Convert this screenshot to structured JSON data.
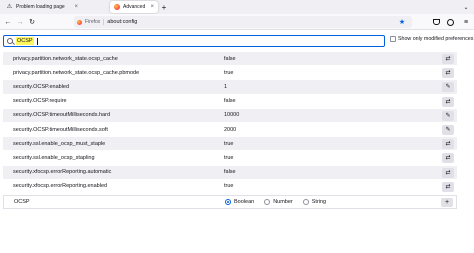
{
  "tabs": [
    {
      "title": "Problem loading page",
      "icon": "warning-icon",
      "active": false
    },
    {
      "title": "Advanced Preferences",
      "icon": "firefox-icon",
      "active": true
    }
  ],
  "tab_close_glyph": "×",
  "new_tab_glyph": "+",
  "tabs_menu_glyph": "⌄",
  "nav": {
    "back": "←",
    "forward": "→",
    "reload": "↻"
  },
  "urlbar": {
    "identity": "Firefox",
    "url": "about:config"
  },
  "toolbar_glyphs": {
    "star": "★",
    "menu": "≡"
  },
  "search": {
    "value": "OCSP"
  },
  "show_modified_label": "Show only modified preferences",
  "prefs": [
    {
      "name": "privacy.partition.network_state.ocsp_cache",
      "value": "false",
      "action": "toggle-icon",
      "glyph": "⇄"
    },
    {
      "name": "privacy.partition.network_state.ocsp_cache.pbmode",
      "value": "true",
      "action": "toggle-icon",
      "glyph": "⇄"
    },
    {
      "name": "security.OCSP.enabled",
      "value": "1",
      "action": "edit-icon",
      "glyph": "✎"
    },
    {
      "name": "security.OCSP.require",
      "value": "false",
      "action": "toggle-icon",
      "glyph": "⇄"
    },
    {
      "name": "security.OCSP.timeoutMilliseconds.hard",
      "value": "10000",
      "action": "edit-icon",
      "glyph": "✎"
    },
    {
      "name": "security.OCSP.timeoutMilliseconds.soft",
      "value": "2000",
      "action": "edit-icon",
      "glyph": "✎"
    },
    {
      "name": "security.ssl.enable_ocsp_must_staple",
      "value": "true",
      "action": "toggle-icon",
      "glyph": "⇄"
    },
    {
      "name": "security.ssl.enable_ocsp_stapling",
      "value": "true",
      "action": "toggle-icon",
      "glyph": "⇄"
    },
    {
      "name": "security.xfocsp.errorReporting.automatic",
      "value": "false",
      "action": "toggle-icon",
      "glyph": "⇄"
    },
    {
      "name": "security.xfocsp.errorReporting.enabled",
      "value": "true",
      "action": "toggle-icon",
      "glyph": "⇄"
    }
  ],
  "add_row": {
    "name": "OCSP",
    "types": [
      {
        "label": "Boolean",
        "checked": true
      },
      {
        "label": "Number",
        "checked": false
      },
      {
        "label": "String",
        "checked": false
      }
    ],
    "add_glyph": "+"
  },
  "colors": {
    "accent": "#0061e0",
    "highlight": "#fff95e",
    "row_alt": "#f0f0f4"
  }
}
